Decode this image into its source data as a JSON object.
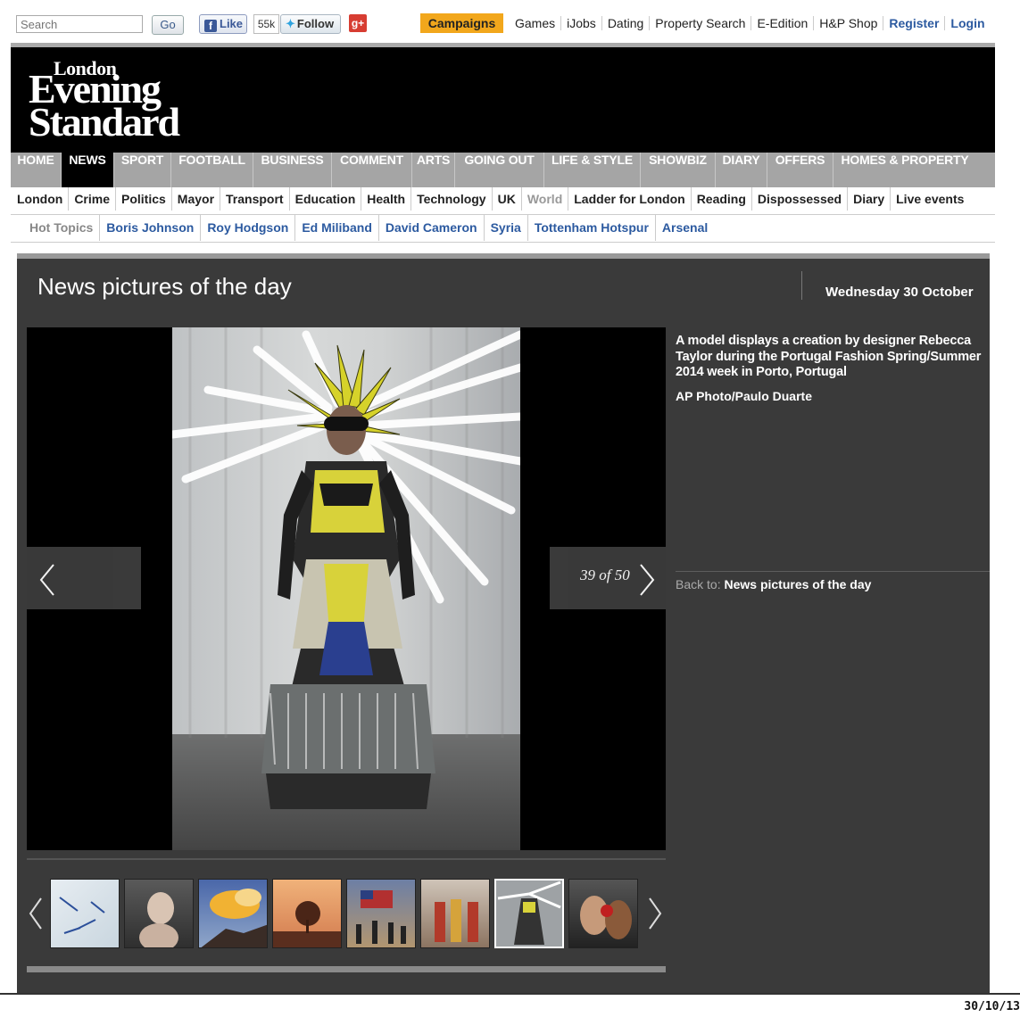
{
  "topbar": {
    "search_placeholder": "Search",
    "go_label": "Go",
    "like_label": "Like",
    "like_count": "55k",
    "follow_label": "Follow",
    "gplus_label": "g+",
    "campaigns_label": "Campaigns",
    "links": [
      "Games",
      "iJobs",
      "Dating",
      "Property Search",
      "E-Edition",
      "H&P Shop"
    ],
    "register_label": "Register",
    "login_label": "Login"
  },
  "masthead": {
    "logo_line1": "London",
    "logo_line2": "Evening",
    "logo_line3": "Standard"
  },
  "mainnav": [
    "HOME",
    "NEWS",
    "SPORT",
    "FOOTBALL",
    "BUSINESS",
    "COMMENT",
    "ARTS",
    "GOING OUT",
    "LIFE & STYLE",
    "SHOWBIZ",
    "DIARY",
    "OFFERS",
    "HOMES & PROPERTY"
  ],
  "mainnav_active": "NEWS",
  "subnav": [
    "London",
    "Crime",
    "Politics",
    "Mayor",
    "Transport",
    "Education",
    "Health",
    "Technology",
    "UK",
    "World",
    "Ladder for London",
    "Reading",
    "Dispossessed",
    "Diary",
    "Live events"
  ],
  "subnav_muted": "World",
  "hottopics": {
    "label": "Hot Topics",
    "items": [
      "Boris Johnson",
      "Roy Hodgson",
      "Ed Miliband",
      "David Cameron",
      "Syria",
      "Tottenham Hotspur",
      "Arsenal"
    ]
  },
  "gallery": {
    "title": "News pictures of the day",
    "date": "Wednesday 30 October",
    "counter": "39 of 50",
    "caption": "A model displays a creation by designer Rebecca Taylor during the Portugal Fashion Spring/Summer 2014 week in Porto, Portugal",
    "credit": "AP Photo/Paulo Duarte",
    "back_label": "Back to:",
    "back_link": "News pictures of the day"
  },
  "footer_stamp": "30/10/13",
  "colors": {
    "campaigns": "#f2a71c",
    "nav_bg": "#a5a5a5",
    "panel_bg": "#3a3a3a",
    "link_blue": "#2c5aa0"
  }
}
